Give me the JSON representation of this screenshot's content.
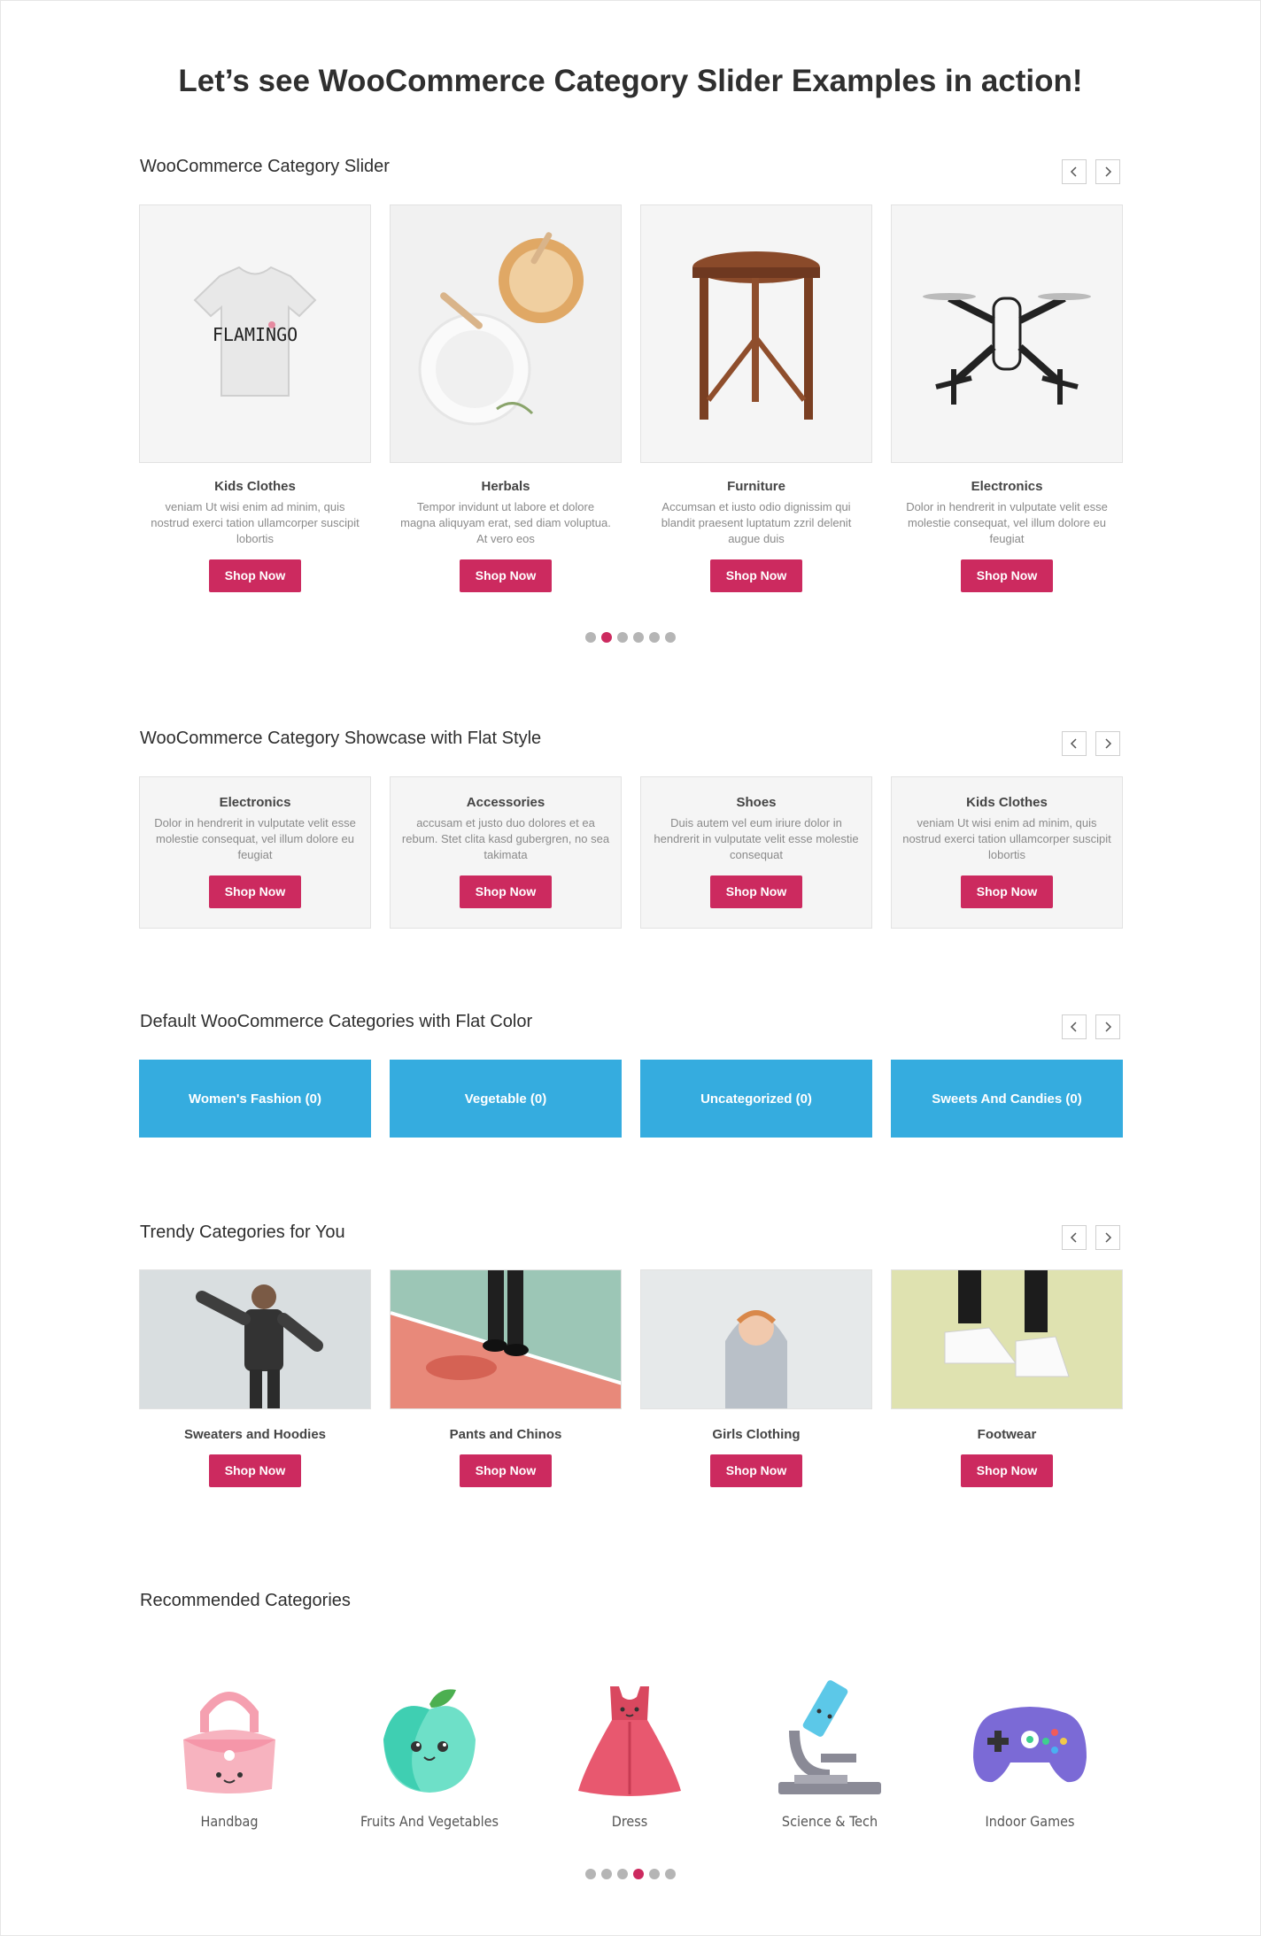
{
  "page": {
    "title": "Let’s see WooCommerce Category Slider Examples in action!"
  },
  "colors": {
    "accent": "#cc2a5f",
    "tile": "#35acdf",
    "card_bg": "#f5f5f5"
  },
  "icons": {
    "prev": "chevron-left-icon",
    "next": "chevron-right-icon"
  },
  "slider": {
    "title": "WooCommerce Category Slider",
    "items": [
      {
        "name": "Kids Clothes",
        "desc": "veniam Ut wisi enim ad minim, quis nostrud exerci tation ullamcorper suscipit lobortis",
        "button": "Shop Now"
      },
      {
        "name": "Herbals",
        "desc": "Tempor invidunt ut labore et dolore magna aliquyam erat, sed diam voluptua. At vero eos",
        "button": "Shop Now"
      },
      {
        "name": "Furniture",
        "desc": "Accumsan et iusto odio dignissim qui blandit praesent luptatum zzril delenit augue duis",
        "button": "Shop Now"
      },
      {
        "name": "Electronics",
        "desc": "Dolor in hendrerit in vulputate velit esse molestie consequat, vel illum dolore eu feugiat",
        "button": "Shop Now"
      }
    ],
    "pagination": {
      "total": 6,
      "active": 2
    }
  },
  "showcase": {
    "title": "WooCommerce Category Showcase with Flat Style",
    "items": [
      {
        "name": "Electronics",
        "desc": "Dolor in hendrerit in vulputate velit esse molestie consequat, vel illum dolore eu feugiat",
        "button": "Shop Now"
      },
      {
        "name": "Accessories",
        "desc": "accusam et justo duo dolores et ea rebum. Stet clita kasd gubergren, no sea takimata",
        "button": "Shop Now"
      },
      {
        "name": "Shoes",
        "desc": "Duis autem vel eum iriure dolor in hendrerit in vulputate velit esse molestie consequat",
        "button": "Shop Now"
      },
      {
        "name": "Kids Clothes",
        "desc": "veniam Ut wisi enim ad minim, quis nostrud exerci tation ullamcorper suscipit lobortis",
        "button": "Shop Now"
      }
    ]
  },
  "default_cats": {
    "title": "Default WooCommerce Categories with Flat Color",
    "items": [
      {
        "label": "Women's Fashion (0)"
      },
      {
        "label": "Vegetable (0)"
      },
      {
        "label": "Uncategorized (0)"
      },
      {
        "label": "Sweets And Candies (0)"
      }
    ]
  },
  "trendy": {
    "title": "Trendy Categories for You",
    "items": [
      {
        "name": "Sweaters and Hoodies",
        "button": "Shop Now"
      },
      {
        "name": "Pants and Chinos",
        "button": "Shop Now"
      },
      {
        "name": "Girls Clothing",
        "button": "Shop Now"
      },
      {
        "name": "Footwear",
        "button": "Shop Now"
      }
    ]
  },
  "recommended": {
    "title": "Recommended Categories",
    "items": [
      {
        "label": "Handbag",
        "icon": "handbag-icon"
      },
      {
        "label": "Fruits And Vegetables",
        "icon": "apple-icon"
      },
      {
        "label": "Dress",
        "icon": "dress-icon"
      },
      {
        "label": "Science & Tech",
        "icon": "microscope-icon"
      },
      {
        "label": "Indoor Games",
        "icon": "gamepad-icon"
      }
    ],
    "pagination": {
      "total": 6,
      "active": 4
    }
  }
}
